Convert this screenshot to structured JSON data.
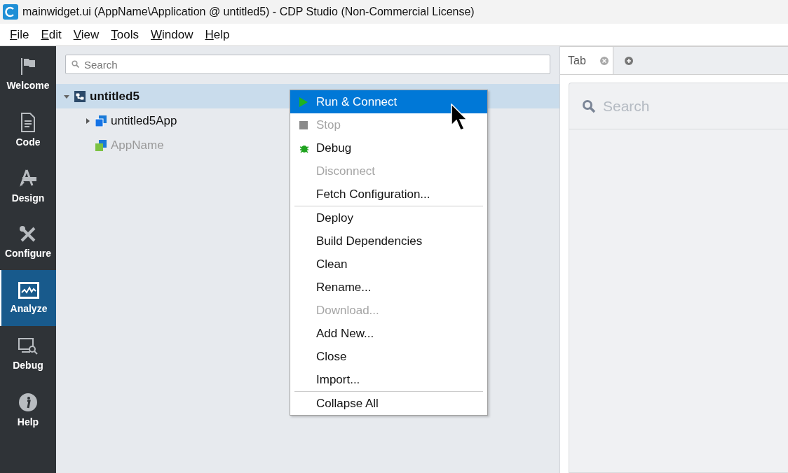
{
  "window": {
    "title": "mainwidget.ui (AppName\\Application @ untitled5) - CDP Studio (Non-Commercial License)"
  },
  "menubar": [
    "File",
    "Edit",
    "View",
    "Tools",
    "Window",
    "Help"
  ],
  "sidebar": {
    "items": [
      {
        "label": "Welcome",
        "kind": "flag",
        "selected": false
      },
      {
        "label": "Code",
        "kind": "document",
        "selected": false
      },
      {
        "label": "Design",
        "kind": "design",
        "selected": false
      },
      {
        "label": "Configure",
        "kind": "tools",
        "selected": false
      },
      {
        "label": "Analyze",
        "kind": "chart",
        "selected": true
      },
      {
        "label": "Debug",
        "kind": "debug",
        "selected": false
      },
      {
        "label": "Help",
        "kind": "info",
        "selected": false
      }
    ]
  },
  "project_pane": {
    "search": {
      "placeholder": "Search"
    },
    "tree": [
      {
        "label": "untitled5",
        "kind": "system",
        "expanded": true,
        "selected": true,
        "disabled": false,
        "children": [
          {
            "label": "untitled5App",
            "kind": "app",
            "expanded": false,
            "selected": false,
            "disabled": false
          },
          {
            "label": "AppName",
            "kind": "qt",
            "selected": false,
            "disabled": true
          }
        ]
      }
    ]
  },
  "context_menu": {
    "groups": [
      [
        {
          "label": "Run & Connect",
          "kind": "play",
          "selected": true,
          "disabled": false
        },
        {
          "label": "Stop",
          "kind": "stop",
          "selected": false,
          "disabled": true
        },
        {
          "label": "Debug",
          "kind": "bug",
          "selected": false,
          "disabled": false
        },
        {
          "label": "Disconnect",
          "kind": "plain",
          "selected": false,
          "disabled": true
        },
        {
          "label": "Fetch Configuration...",
          "kind": "plain",
          "selected": false,
          "disabled": false
        }
      ],
      [
        {
          "label": "Deploy",
          "kind": "plain",
          "selected": false,
          "disabled": false
        },
        {
          "label": "Build Dependencies",
          "kind": "plain",
          "selected": false,
          "disabled": false
        },
        {
          "label": "Clean",
          "kind": "plain",
          "selected": false,
          "disabled": false
        },
        {
          "label": "Rename...",
          "kind": "plain",
          "selected": false,
          "disabled": false
        },
        {
          "label": "Download...",
          "kind": "plain",
          "selected": false,
          "disabled": true
        },
        {
          "label": "Add New...",
          "kind": "plain",
          "selected": false,
          "disabled": false
        },
        {
          "label": "Close",
          "kind": "plain",
          "selected": false,
          "disabled": false
        },
        {
          "label": "Import...",
          "kind": "plain",
          "selected": false,
          "disabled": false
        }
      ],
      [
        {
          "label": "Collapse All",
          "kind": "plain",
          "selected": false,
          "disabled": false
        }
      ]
    ]
  },
  "right_pane": {
    "tabs": [
      {
        "label": "Tab",
        "selected": true
      }
    ],
    "search": {
      "placeholder": "Search"
    }
  }
}
